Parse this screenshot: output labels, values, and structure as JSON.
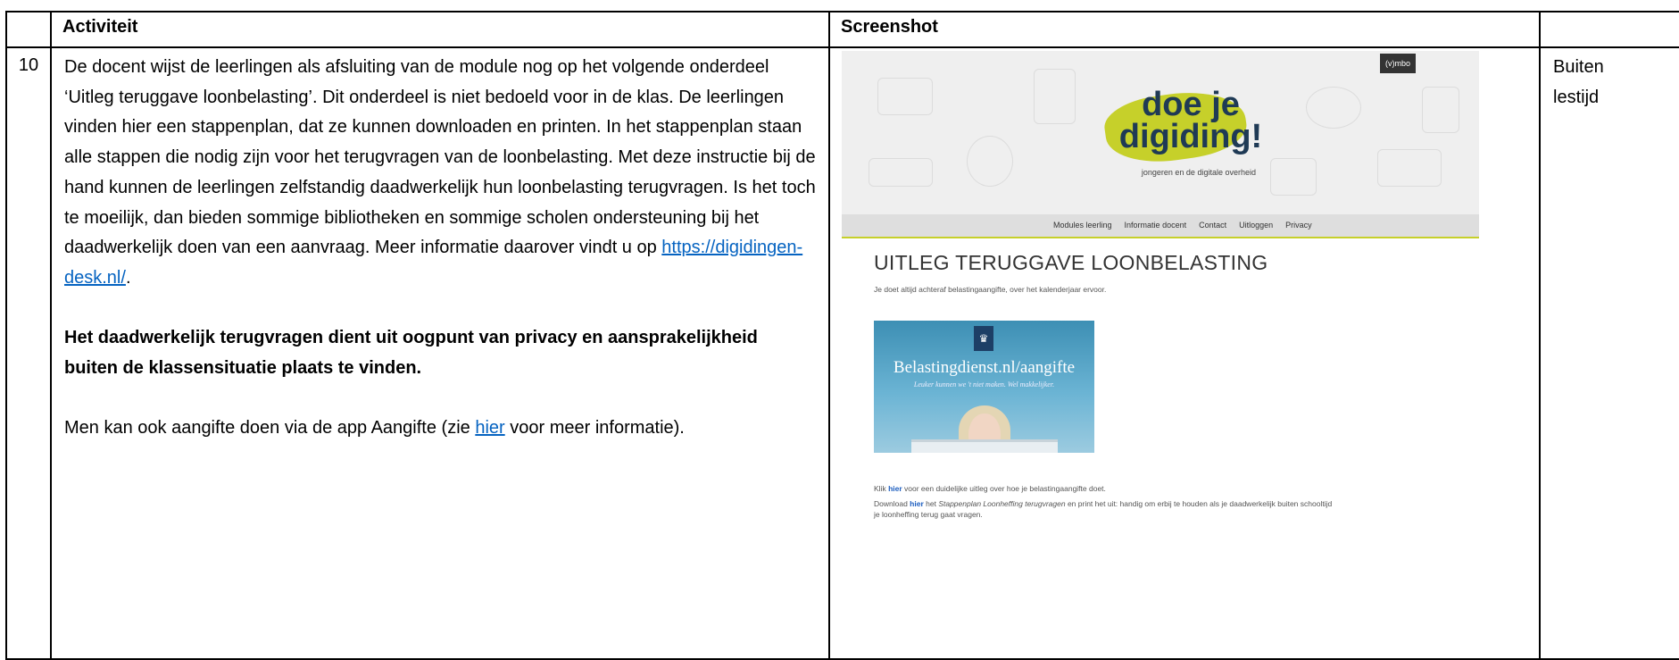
{
  "table": {
    "headers": {
      "num": "",
      "activity": "Activiteit",
      "screenshot": "Screenshot",
      "time": ""
    },
    "row": {
      "number": "10",
      "paragraph1": "De docent wijst de leerlingen als afsluiting van de module nog op het volgende onderdeel ‘Uitleg teruggave loonbelasting’. Dit onderdeel is niet bedoeld voor in de klas. De leerlingen vinden hier een stappenplan, dat ze kunnen downloaden en printen. In het stappenplan staan alle stappen die nodig zijn voor het terugvragen van de loonbelasting. Met deze instructie bij de hand kunnen de leerlingen zelfstandig daadwerkelijk hun loonbelasting terugvragen. Is het toch te moeilijk, dan bieden sommige bibliotheken en sommige scholen ondersteuning bij het daadwerkelijk doen van een aanvraag. Meer informatie daarover vindt u op ",
      "link_desk": "https://digidingen-desk.nl/",
      "paragraph1_end": ".",
      "bold_paragraph": "Het daadwerkelijk terugvragen dient uit oogpunt van privacy en aansprakelijkheid buiten de klassensituatie plaats te vinden.",
      "paragraph3_start": "Men kan ook aangifte doen via de app Aangifte (zie ",
      "link_hier": "hier",
      "paragraph3_end": " voor meer informatie).",
      "time_line1": "Buiten",
      "time_line2": "lestijd"
    }
  },
  "screenshot": {
    "tag": "(v)mbo",
    "logo_line1": "doe je",
    "logo_line2": "digiding!",
    "logo_tagline": "jongeren en de digitale overheid",
    "nav": [
      "Modules leerling",
      "Informatie docent",
      "Contact",
      "Uitloggen",
      "Privacy"
    ],
    "page_title": "UITLEG TERUGGAVE LOONBELASTING",
    "intro": "Je doet altijd achteraf belastingaangifte, over het kalenderjaar ervoor.",
    "promo_title": "Belastingdienst.nl/aangifte",
    "promo_sub": "Leuker kunnen we 't niet maken. Wel makkelijker.",
    "line1_a": "Klik ",
    "line1_link": "hier",
    "line1_b": " voor een duidelijke uitleg over hoe je belastingaangifte doet.",
    "line2_a": "Download ",
    "line2_link": "hier",
    "line2_b": " het ",
    "line2_italic": "Stappenplan Loonheffing terugvragen",
    "line2_c": " en print het uit: handig om erbij te houden als je daadwerkelijk buiten schooltijd je loonheffing terug gaat vragen."
  }
}
